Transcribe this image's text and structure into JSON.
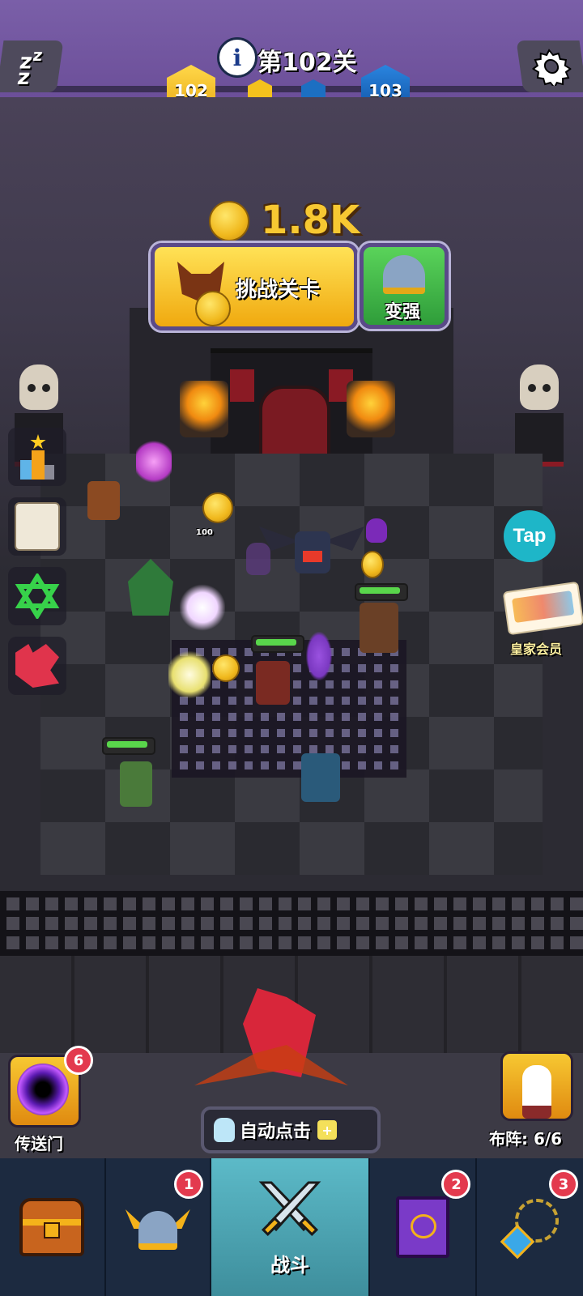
{
  "header": {
    "level_title": "第102关",
    "current_level": "102",
    "next_level": "103"
  },
  "coins": {
    "amount": "1.8K",
    "drop_label": "100"
  },
  "actions": {
    "challenge_label": "挑战关卡",
    "upgrade_label": "变强"
  },
  "right_panel": {
    "tap_label": "Tap",
    "vip_label": "皇家会员"
  },
  "portal": {
    "label": "传送门",
    "badge": "6"
  },
  "auto_click": {
    "label": "自动点击"
  },
  "formation": {
    "label": "布阵: 6/6"
  },
  "nav": {
    "tabs": [
      {
        "label": "",
        "badge": "",
        "icon": "treasure-chest-icon"
      },
      {
        "label": "",
        "badge": "1",
        "icon": "viking-helmet-icon"
      },
      {
        "label": "战斗",
        "badge": "",
        "icon": "crossed-swords-icon"
      },
      {
        "label": "",
        "badge": "2",
        "icon": "spellbook-icon"
      },
      {
        "label": "",
        "badge": "3",
        "icon": "amulet-icon"
      }
    ],
    "active_tab": 2
  },
  "colors": {
    "topbar": "#6c4f99",
    "gold": "#f4c21d",
    "green_button": "#3fc14a",
    "nav_bg": "#1c2a40",
    "nav_active": "#4fa8b4",
    "badge": "#e33a4e"
  }
}
